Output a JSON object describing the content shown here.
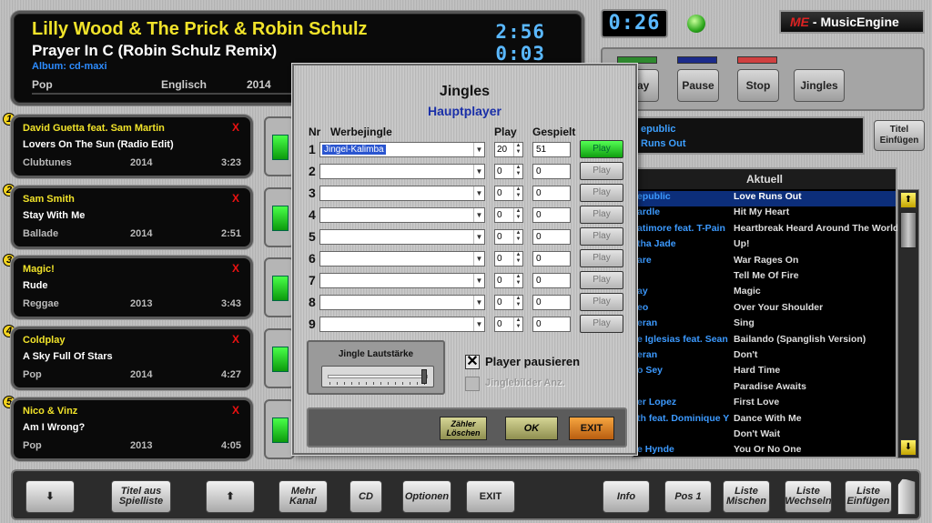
{
  "now_playing": {
    "artist": "Lilly Wood & The Prick & Robin Schulz",
    "title": "Prayer In C (Robin Schulz Remix)",
    "album": "Album: cd-maxi",
    "genre": "Pop",
    "language": "Englisch",
    "year": "2014",
    "time_elapsed": "2:56",
    "time_remaining": "0:03"
  },
  "clock": "0:26",
  "logo": {
    "prefix": "ME",
    "text": " - MusicEngine"
  },
  "transport": {
    "play": "Play",
    "pause": "Pause",
    "stop": "Stop",
    "jingles": "Jingles"
  },
  "transport_leds": {
    "play": "#2f8a2f",
    "pause": "#1b2a8a",
    "stop": "#d04040"
  },
  "playlist": [
    {
      "num": "1",
      "artist": "David Guetta feat. Sam Martin",
      "title": "Lovers On The Sun (Radio Edit)",
      "genre": "Clubtunes",
      "year": "2014",
      "duration": "3:23",
      "remove": "X"
    },
    {
      "num": "2",
      "artist": "Sam Smith",
      "title": "Stay With Me",
      "genre": "Ballade",
      "year": "2014",
      "duration": "2:51",
      "remove": "X"
    },
    {
      "num": "3",
      "artist": "Magic!",
      "title": "Rude",
      "genre": "Reggae",
      "year": "2013",
      "duration": "3:43",
      "remove": "X"
    },
    {
      "num": "4",
      "artist": "Coldplay",
      "title": "A Sky Full Of Stars",
      "genre": "Pop",
      "year": "2014",
      "duration": "4:27",
      "remove": "X"
    },
    {
      "num": "5",
      "artist": "Nico & Vinz",
      "title": "Am I Wrong?",
      "genre": "Pop",
      "year": "2013",
      "duration": "4:05",
      "remove": "X"
    }
  ],
  "info_box": {
    "line1": "epublic",
    "line2": "Runs Out"
  },
  "title_insert": "Titel\nEinfügen",
  "current_list": {
    "header": "Aktuell",
    "rows": [
      {
        "artist": "epublic",
        "title": "Love Runs Out",
        "selected": true
      },
      {
        "artist": "ardle",
        "title": "Hit My Heart"
      },
      {
        "artist": "atimore feat. T-Pain",
        "title": "Heartbreak Heard Around The World"
      },
      {
        "artist": "tha Jade",
        "title": "Up!"
      },
      {
        "artist": "are",
        "title": "War Rages On"
      },
      {
        "artist": "",
        "title": "Tell Me Of Fire"
      },
      {
        "artist": "ay",
        "title": "Magic"
      },
      {
        "artist": "eo",
        "title": "Over Your Shoulder"
      },
      {
        "artist": "eran",
        "title": "Sing"
      },
      {
        "artist": "e Iglesias feat. Sean",
        "title": "Bailando (Spanglish Version)"
      },
      {
        "artist": "eran",
        "title": "Don't"
      },
      {
        "artist": "o Sey",
        "title": "Hard Time"
      },
      {
        "artist": "",
        "title": "Paradise Awaits"
      },
      {
        "artist": "er Lopez",
        "title": "First Love"
      },
      {
        "artist": "th feat. Dominique Y",
        "title": "Dance With Me"
      },
      {
        "artist": "",
        "title": "Don't Wait"
      },
      {
        "artist": "e Hynde",
        "title": "You Or No One"
      }
    ]
  },
  "dialog": {
    "title": "Jingles",
    "subtitle": "Hauptplayer",
    "col_nr": "Nr",
    "col_jingle": "Werbejingle",
    "col_play": "Play",
    "col_played": "Gespielt",
    "rows": [
      {
        "nr": "1",
        "jingle": "Jingel-Kalimba",
        "play": "20",
        "played": "51",
        "button": "Play",
        "active": true
      },
      {
        "nr": "2",
        "jingle": "",
        "play": "0",
        "played": "0",
        "button": "Play"
      },
      {
        "nr": "3",
        "jingle": "",
        "play": "0",
        "played": "0",
        "button": "Play"
      },
      {
        "nr": "4",
        "jingle": "",
        "play": "0",
        "played": "0",
        "button": "Play"
      },
      {
        "nr": "5",
        "jingle": "",
        "play": "0",
        "played": "0",
        "button": "Play"
      },
      {
        "nr": "6",
        "jingle": "",
        "play": "0",
        "played": "0",
        "button": "Play"
      },
      {
        "nr": "7",
        "jingle": "",
        "play": "0",
        "played": "0",
        "button": "Play"
      },
      {
        "nr": "8",
        "jingle": "",
        "play": "0",
        "played": "0",
        "button": "Play"
      },
      {
        "nr": "9",
        "jingle": "",
        "play": "0",
        "played": "0",
        "button": "Play"
      }
    ],
    "volume_label": "Jingle Lautstärke",
    "volume_level": 0.95,
    "pause_player": "Player pausieren",
    "pause_player_checked": true,
    "jingle_images": "Jinglebilder Anz.",
    "reset_counter": "Zähler\nLöschen",
    "ok": "OK",
    "exit": "EXIT"
  },
  "bottom_bar": {
    "down": "⬇",
    "title_from_playlist": "Titel aus\nSpielliste",
    "up": "⬆",
    "more_channel": "Mehr\nKanal",
    "cd": "CD",
    "options": "Optionen",
    "exit": "EXIT",
    "info": "Info",
    "pos1": "Pos 1",
    "mix_list": "Liste\nMischen",
    "change_list": "Liste\nWechseln",
    "insert_list": "Liste\nEinfügen"
  }
}
